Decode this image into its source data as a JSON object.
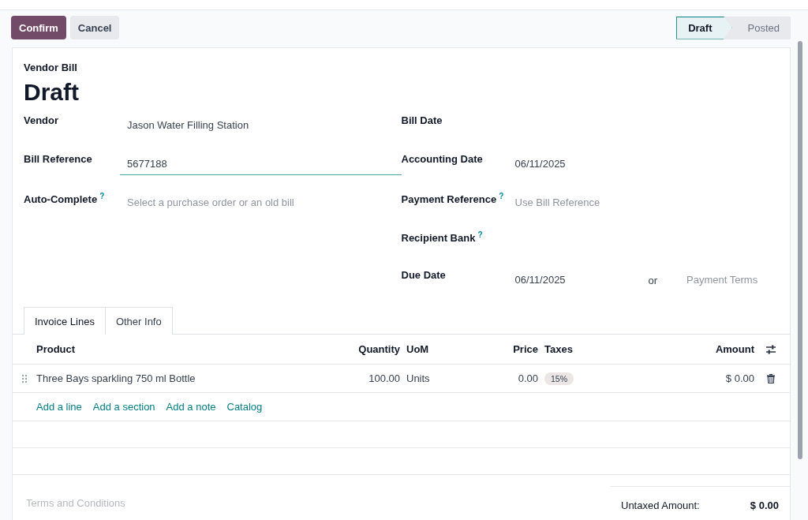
{
  "actions": [
    {
      "label": "Confirm",
      "kind": "primary"
    },
    {
      "label": "Cancel",
      "kind": "secondary"
    }
  ],
  "stages": [
    {
      "label": "Draft",
      "selected": true
    },
    {
      "label": "Posted",
      "selected": false
    }
  ],
  "form": {
    "type_label": "Vendor Bill",
    "title": "Draft",
    "left_fields": [
      {
        "label": "Vendor",
        "help": false,
        "value": "Jason Water Filling Station",
        "focused": false
      },
      {
        "label": "Bill Reference",
        "help": false,
        "value": "5677188",
        "focused": true
      },
      {
        "label": "Auto-Complete",
        "help": true,
        "placeholder": "Select a purchase order or an old bill",
        "focused": false
      }
    ],
    "right_fields": [
      {
        "label": "Bill Date",
        "help": false,
        "focused": false
      },
      {
        "label": "Accounting Date",
        "help": false,
        "value": "06/11/2025",
        "focused": false
      },
      {
        "label": "Payment Reference",
        "help": true,
        "placeholder": "Use Bill Reference",
        "focused": false
      },
      {
        "label": "Recipient Bank",
        "help": true,
        "focused": false
      },
      {
        "label": "Due Date",
        "help": false,
        "value": "06/11/2025",
        "focused": false,
        "separator": "or",
        "alt_placeholder": "Payment Terms"
      }
    ]
  },
  "help_mark": "?",
  "tabs": [
    {
      "label": "Invoice Lines",
      "selected": true
    },
    {
      "label": "Other Info",
      "selected": false
    }
  ],
  "table": {
    "columns": [
      "Product",
      "Quantity",
      "UoM",
      "Price",
      "Taxes",
      "Amount"
    ],
    "rows": [
      {
        "product": "Three Bays sparkling 750 ml Bottle",
        "quantity": "100.00",
        "uom": "Units",
        "price": "0.00",
        "taxes": [
          "15%"
        ],
        "amount": "$ 0.00"
      }
    ],
    "add_links": [
      "Add a line",
      "Add a section",
      "Add a note",
      "Catalog"
    ]
  },
  "terms": {
    "placeholder": "Terms and Conditions"
  },
  "totals": [
    {
      "label": "Untaxed Amount:",
      "value": "$ 0.00"
    }
  ]
}
